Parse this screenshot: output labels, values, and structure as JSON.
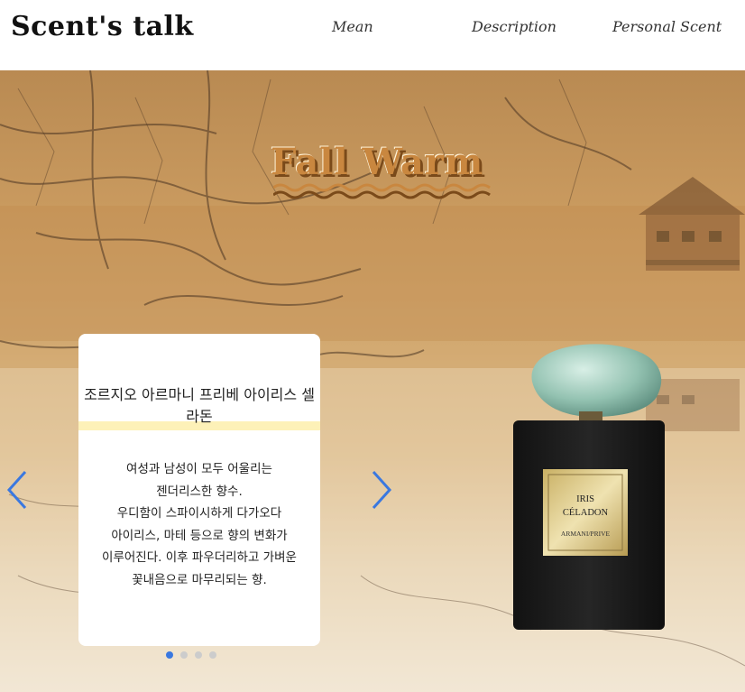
{
  "header": {
    "logo": "Scent's talk",
    "nav": [
      "Mean",
      "Description",
      "Personal Scent"
    ]
  },
  "hero": {
    "title": "Fall Warm",
    "product": {
      "name": "조르지오 아르마니 프리베 아이리스 셀라돈",
      "description": [
        "여성과 남성이 모두 어울리는",
        "젠더리스한 향수.",
        "우디함이 스파이시하게 다가오다",
        "아이리스, 마테 등으로 향의 변화가",
        "이루어진다. 이후 파우더리하고 가벼운",
        "꽃내음으로 마무리되는 향."
      ],
      "label_line1": "IRIS",
      "label_line2": "CÉLADON",
      "label_brand": "ARMANI/PRIVE"
    }
  },
  "carousel": {
    "active_index": 0,
    "count": 4,
    "accent": "#3a78e0"
  },
  "icons": {
    "prev": "chevron-left-icon",
    "next": "chevron-right-icon"
  }
}
